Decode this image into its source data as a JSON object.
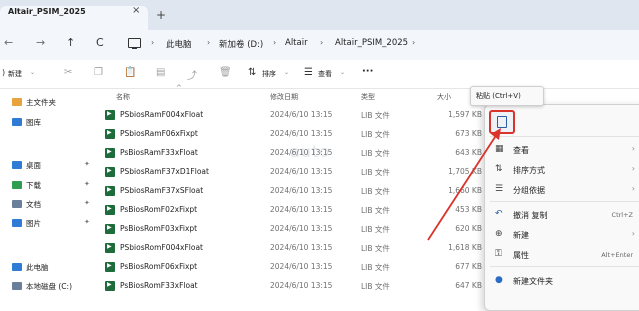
{
  "window": {
    "tab_title": "Altair_PSIM_2025",
    "close_glyph": "×",
    "new_tab_glyph": "+"
  },
  "nav": {
    "back": "←",
    "forward": "→",
    "up": "↑",
    "refresh": "C",
    "breadcrumb": [
      "此电脑",
      "新加卷 (D:)",
      "Altair",
      "Altair_PSIM_2025"
    ],
    "sep": "›"
  },
  "toolbar": {
    "new_label": "新建",
    "sort_label": "排序",
    "view_label": "查看",
    "more": "···",
    "tooltip": "粘贴 (Ctrl+V)"
  },
  "sidebar": [
    {
      "label": "主文件夹",
      "icon": "home-icon",
      "color": "#e8a33d"
    },
    {
      "label": "图库",
      "icon": "gallery-icon",
      "color": "#2f7bd6"
    },
    {
      "label": "桌面",
      "icon": "desktop-icon",
      "color": "#2f7bd6",
      "pinned": true
    },
    {
      "label": "下载",
      "icon": "download-icon",
      "color": "#2f9e52",
      "pinned": true
    },
    {
      "label": "文档",
      "icon": "document-icon",
      "color": "#6a7f99",
      "pinned": true
    },
    {
      "label": "图片",
      "icon": "pictures-icon",
      "color": "#2f7bd6",
      "pinned": true
    },
    {
      "label": "此电脑",
      "icon": "this-pc-icon",
      "color": "#2f7bd6"
    },
    {
      "label": "本地磁盘 (C:)",
      "icon": "drive-icon",
      "color": "#6a7f99"
    }
  ],
  "columns": {
    "name": "名称",
    "date": "修改日期",
    "type": "类型",
    "size": "大小"
  },
  "files": [
    {
      "name": "PSbiosRamF004xFloat",
      "date": "2024/6/10 13:15",
      "type": "LIB 文件",
      "size": "1,597 KB"
    },
    {
      "name": "PSbiosRamF06xFixpt",
      "date": "2024/6/10 13:15",
      "type": "LIB 文件",
      "size": "673 KB"
    },
    {
      "name": "PsBiosRamF33xFloat",
      "date": "2024/6/10 13:15",
      "type": "LIB 文件",
      "size": "643 KB"
    },
    {
      "name": "PSbiosRamF37xD1Float",
      "date": "2024/6/10 13:15",
      "type": "LIB 文件",
      "size": "1,705 KB"
    },
    {
      "name": "PSbiosRamF37xSFloat",
      "date": "2024/6/10 13:15",
      "type": "LIB 文件",
      "size": "1,660 KB"
    },
    {
      "name": "PsBiosRomF02xFixpt",
      "date": "2024/6/10 13:15",
      "type": "LIB 文件",
      "size": "453 KB"
    },
    {
      "name": "PsBiosRomF03xFixpt",
      "date": "2024/6/10 13:15",
      "type": "LIB 文件",
      "size": "620 KB"
    },
    {
      "name": "PSbiosRomF004xFloat",
      "date": "2024/6/10 13:15",
      "type": "LIB 文件",
      "size": "1,618 KB"
    },
    {
      "name": "PsBiosRomF06xFixpt",
      "date": "2024/6/10 13:15",
      "type": "LIB 文件",
      "size": "677 KB"
    },
    {
      "name": "PsBiosRomF33xFloat",
      "date": "2024/6/10 13:15",
      "type": "LIB 文件",
      "size": "647 KB"
    }
  ],
  "context_menu": {
    "items": [
      {
        "label": "查看",
        "icon": "view-icon",
        "glyph": "▦",
        "arrow": "›"
      },
      {
        "label": "排序方式",
        "icon": "sort-icon",
        "glyph": "⇅",
        "arrow": "›"
      },
      {
        "label": "分组依据",
        "icon": "group-icon",
        "glyph": "☰",
        "arrow": "›"
      },
      {
        "label": "撤消 复制",
        "icon": "undo-icon",
        "glyph": "↶",
        "shortcut": "Ctrl+Z"
      },
      {
        "label": "新建",
        "icon": "new-icon",
        "glyph": "⊕",
        "arrow": "›"
      },
      {
        "label": "属性",
        "icon": "properties-icon",
        "glyph": "⚿",
        "shortcut": "Alt+Enter"
      },
      {
        "label": "新建文件夹",
        "icon": "new-folder-icon",
        "glyph": "●"
      }
    ]
  },
  "colors": {
    "accent_red": "#d9332b",
    "file_icon_green": "#1e6b3b"
  }
}
